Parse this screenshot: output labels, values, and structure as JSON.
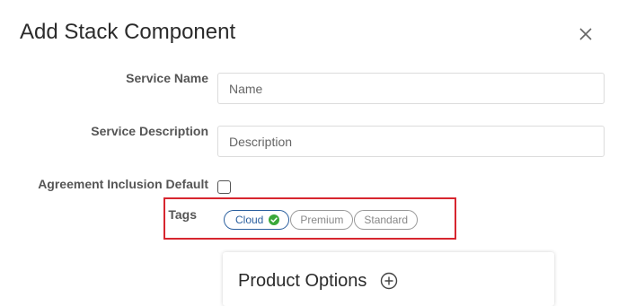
{
  "dialog": {
    "title": "Add Stack Component",
    "close_icon": "close-icon"
  },
  "form": {
    "service_name": {
      "label": "Service Name",
      "placeholder": "Name",
      "value": ""
    },
    "service_description": {
      "label": "Service Description",
      "placeholder": "Description",
      "value": ""
    },
    "agreement_inclusion_default": {
      "label": "Agreement Inclusion Default",
      "checked": false
    },
    "tags": {
      "label": "Tags",
      "chips": [
        {
          "label": "Cloud",
          "selected": true,
          "icon": "check-circle-icon"
        },
        {
          "label": "Premium",
          "selected": false
        },
        {
          "label": "Standard",
          "selected": false
        }
      ]
    }
  },
  "product_options": {
    "title": "Product Options",
    "add_icon": "plus-circle-icon"
  },
  "colors": {
    "highlight": "#d7262f",
    "chip_selected": "#2a5f9e",
    "check_green": "#3aa83a"
  }
}
